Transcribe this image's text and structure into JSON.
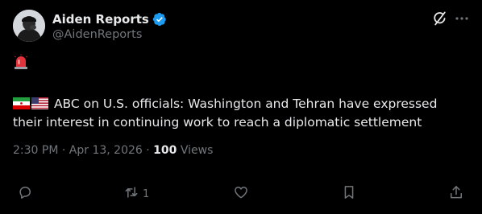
{
  "author": {
    "name": "Aiden Reports",
    "handle": "@AidenReports",
    "verified": true
  },
  "header_icons": [
    "grok-icon",
    "more-icon"
  ],
  "post": {
    "emoji_line": "siren-emoji",
    "flags": [
      "iran-flag",
      "us-flag"
    ],
    "text": "ABC on U.S. officials: Washington and Tehran have expressed their interest in continuing work to reach a diplomatic settlement"
  },
  "meta": {
    "time": "2:30 PM",
    "separator": "·",
    "date": "Apr 13, 2026",
    "views_count": "100",
    "views_label": "Views"
  },
  "actions": [
    {
      "name": "reply",
      "icon": "reply-icon",
      "count": ""
    },
    {
      "name": "repost",
      "icon": "repost-icon",
      "count": "1"
    },
    {
      "name": "like",
      "icon": "heart-icon",
      "count": ""
    },
    {
      "name": "bookmark",
      "icon": "bookmark-icon",
      "count": ""
    },
    {
      "name": "share",
      "icon": "share-icon",
      "count": ""
    }
  ],
  "colors": {
    "background": "#000000",
    "primary_text": "#e7e9ea",
    "secondary_text": "#71767b",
    "verified_blue": "#1d9bf0"
  }
}
